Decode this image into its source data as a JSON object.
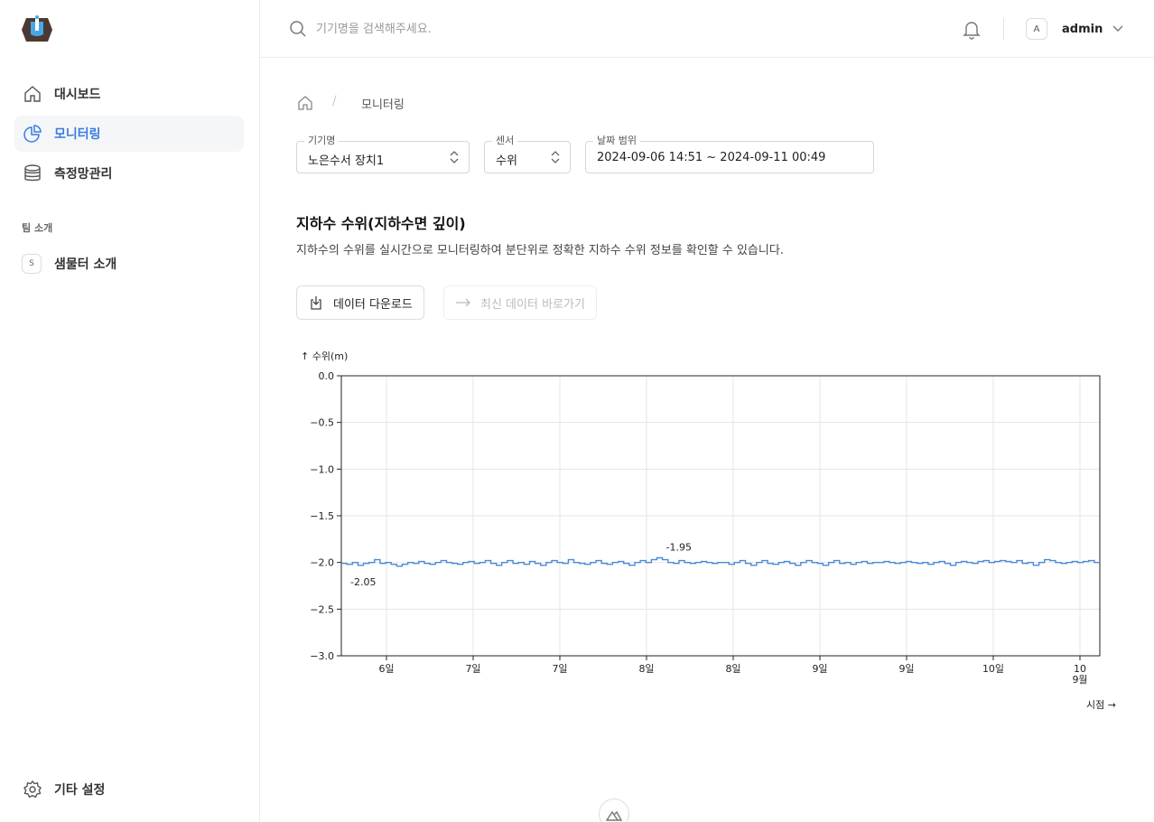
{
  "sidebar": {
    "items": [
      {
        "label": "대시보드",
        "icon": "home-icon"
      },
      {
        "label": "모니터링",
        "icon": "pie-chart-icon",
        "active": true
      },
      {
        "label": "측정망관리",
        "icon": "database-icon"
      }
    ],
    "team_section_title": "팀 소개",
    "team_items": [
      {
        "badge": "S",
        "label": "샘물터 소개"
      }
    ],
    "settings_label": "기타 설정"
  },
  "header": {
    "search_placeholder": "기기명을 검색해주세요.",
    "user_initial": "A",
    "user_name": "admin"
  },
  "breadcrumb": {
    "current": "모니터링"
  },
  "filters": {
    "device": {
      "label": "기기명",
      "value": "노은수서 장치1"
    },
    "sensor": {
      "label": "센서",
      "value": "수위"
    },
    "date_range": {
      "label": "날짜 범위",
      "value": "2024-09-06 14:51 ~ 2024-09-11 00:49"
    }
  },
  "section": {
    "title": "지하수 수위(지하수면 깊이)",
    "description": "지하수의 수위를 실시간으로 모니터링하여 분단위로 정확한 지하수 수위 정보를 확인할 수 있습니다."
  },
  "actions": {
    "download_label": "데이터 다운로드",
    "latest_label": "최신 데이터 바로가기"
  },
  "colors": {
    "accent": "#3a7be0",
    "series": "#4a8ad6"
  },
  "chart_data": {
    "type": "line",
    "ylabel": "↑ 수위(m)",
    "xlabel": "시점 →",
    "ylim": [
      -3.0,
      0.0
    ],
    "yticks": [
      "0.0",
      "−0.5",
      "−1.0",
      "−1.5",
      "−2.0",
      "−2.5",
      "−3.0"
    ],
    "xticks": [
      "6일",
      "7일",
      "7일",
      "8일",
      "8일",
      "9일",
      "9일",
      "10일",
      "10"
    ],
    "xtick_sublabel": "9월",
    "grid": true,
    "annotations": [
      {
        "text": "-1.95",
        "x_frac": 0.428,
        "value": -1.95
      },
      {
        "text": "-2.05",
        "x_frac": 0.012,
        "value": -2.05
      }
    ],
    "series": [
      {
        "values": [
          -2.01,
          -2.02,
          -2.0,
          -2.03,
          -2.01,
          -2.0,
          -1.97,
          -2.01,
          -2.0,
          -2.02,
          -2.04,
          -2.02,
          -2.0,
          -2.01,
          -1.99,
          -2.01,
          -2.02,
          -2.0,
          -1.98,
          -2.0,
          -2.01,
          -2.02,
          -2.0,
          -1.99,
          -2.01,
          -2.0,
          -1.98,
          -2.01,
          -2.03,
          -2.0,
          -1.98,
          -2.01,
          -2.0,
          -2.02,
          -1.99,
          -2.01,
          -2.03,
          -2.0,
          -1.98,
          -2.0,
          -2.01,
          -1.97,
          -2.0,
          -2.01,
          -2.02,
          -2.0,
          -1.98,
          -2.01,
          -2.02,
          -2.0,
          -1.99,
          -2.01,
          -2.03,
          -2.0,
          -1.98,
          -2.0,
          -1.97,
          -1.95,
          -1.97,
          -2.0,
          -2.01,
          -1.98,
          -2.0,
          -2.01,
          -2.0,
          -1.99,
          -2.0,
          -2.01,
          -2.0,
          -2.0,
          -2.02,
          -2.0,
          -1.98,
          -2.01,
          -2.03,
          -2.0,
          -1.98,
          -2.01,
          -2.02,
          -2.0,
          -1.99,
          -2.01,
          -2.03,
          -2.0,
          -1.98,
          -2.0,
          -2.01,
          -2.03,
          -2.0,
          -1.98,
          -2.01,
          -2.0,
          -2.02,
          -2.0,
          -1.99,
          -2.01,
          -2.0,
          -2.0,
          -1.99,
          -2.0,
          -2.01,
          -2.0,
          -1.99,
          -2.0,
          -2.01,
          -2.0,
          -2.02,
          -2.0,
          -1.99,
          -2.01,
          -2.03,
          -2.0,
          -1.99,
          -2.0,
          -2.01,
          -1.99,
          -1.98,
          -2.0,
          -1.99,
          -1.98,
          -1.99,
          -2.0,
          -1.98,
          -2.01,
          -2.0,
          -2.03,
          -2.0,
          -1.97,
          -1.98,
          -2.0,
          -2.01,
          -2.0,
          -1.99,
          -2.0,
          -1.99,
          -1.98,
          -2.0
        ]
      }
    ]
  }
}
